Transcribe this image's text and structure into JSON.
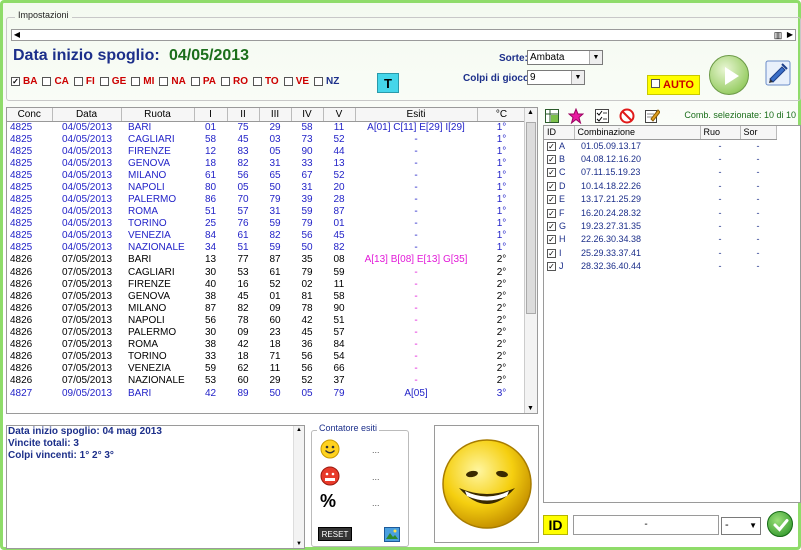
{
  "settings": {
    "title": "Impostazioni",
    "date_label": "Data inizio spoglio:",
    "date_value": "04/05/2013",
    "wheels": [
      {
        "label": "BA",
        "checked": true
      },
      {
        "label": "CA",
        "checked": false
      },
      {
        "label": "FI",
        "checked": false
      },
      {
        "label": "GE",
        "checked": false
      },
      {
        "label": "MI",
        "checked": false
      },
      {
        "label": "NA",
        "checked": false
      },
      {
        "label": "PA",
        "checked": false
      },
      {
        "label": "RO",
        "checked": false
      },
      {
        "label": "TO",
        "checked": false
      },
      {
        "label": "VE",
        "checked": false
      },
      {
        "label": "NZ",
        "checked": false
      }
    ],
    "t_button": "T",
    "sorte_label": "Sorte:",
    "sorte_value": "Ambata",
    "colpi_label": "Colpi di gioco:",
    "colpi_value": "9",
    "auto_label": "AUTO"
  },
  "grid": {
    "columns": [
      "Conc",
      "Data",
      "Ruota",
      "I",
      "II",
      "III",
      "IV",
      "V",
      "Esiti",
      "°C"
    ],
    "rows": [
      [
        "4825",
        "04/05/2013",
        "BARI",
        "01",
        "75",
        "29",
        "58",
        "11",
        "A[01] C[11] E[29] I[29]",
        "1°"
      ],
      [
        "4825",
        "04/05/2013",
        "CAGLIARI",
        "58",
        "45",
        "03",
        "73",
        "52",
        "-",
        "1°"
      ],
      [
        "4825",
        "04/05/2013",
        "FIRENZE",
        "12",
        "83",
        "05",
        "90",
        "44",
        "-",
        "1°"
      ],
      [
        "4825",
        "04/05/2013",
        "GENOVA",
        "18",
        "82",
        "31",
        "33",
        "13",
        "-",
        "1°"
      ],
      [
        "4825",
        "04/05/2013",
        "MILANO",
        "61",
        "56",
        "65",
        "67",
        "52",
        "-",
        "1°"
      ],
      [
        "4825",
        "04/05/2013",
        "NAPOLI",
        "80",
        "05",
        "50",
        "31",
        "20",
        "-",
        "1°"
      ],
      [
        "4825",
        "04/05/2013",
        "PALERMO",
        "86",
        "70",
        "79",
        "39",
        "28",
        "-",
        "1°"
      ],
      [
        "4825",
        "04/05/2013",
        "ROMA",
        "51",
        "57",
        "31",
        "59",
        "87",
        "-",
        "1°"
      ],
      [
        "4825",
        "04/05/2013",
        "TORINO",
        "25",
        "76",
        "59",
        "79",
        "01",
        "-",
        "1°"
      ],
      [
        "4825",
        "04/05/2013",
        "VENEZIA",
        "84",
        "61",
        "82",
        "56",
        "45",
        "-",
        "1°"
      ],
      [
        "4825",
        "04/05/2013",
        "NAZIONALE",
        "34",
        "51",
        "59",
        "50",
        "82",
        "-",
        "1°"
      ],
      [
        "4826",
        "07/05/2013",
        "BARI",
        "13",
        "77",
        "87",
        "35",
        "08",
        "A[13] B[08] E[13] G[35]",
        "2°"
      ],
      [
        "4826",
        "07/05/2013",
        "CAGLIARI",
        "30",
        "53",
        "61",
        "79",
        "59",
        "-",
        "2°"
      ],
      [
        "4826",
        "07/05/2013",
        "FIRENZE",
        "40",
        "16",
        "52",
        "02",
        "11",
        "-",
        "2°"
      ],
      [
        "4826",
        "07/05/2013",
        "GENOVA",
        "38",
        "45",
        "01",
        "81",
        "58",
        "-",
        "2°"
      ],
      [
        "4826",
        "07/05/2013",
        "MILANO",
        "87",
        "82",
        "09",
        "78",
        "90",
        "-",
        "2°"
      ],
      [
        "4826",
        "07/05/2013",
        "NAPOLI",
        "56",
        "78",
        "60",
        "42",
        "51",
        "-",
        "2°"
      ],
      [
        "4826",
        "07/05/2013",
        "PALERMO",
        "30",
        "09",
        "23",
        "45",
        "57",
        "-",
        "2°"
      ],
      [
        "4826",
        "07/05/2013",
        "ROMA",
        "38",
        "42",
        "18",
        "36",
        "84",
        "-",
        "2°"
      ],
      [
        "4826",
        "07/05/2013",
        "TORINO",
        "33",
        "18",
        "71",
        "56",
        "54",
        "-",
        "2°"
      ],
      [
        "4826",
        "07/05/2013",
        "VENEZIA",
        "59",
        "62",
        "11",
        "56",
        "66",
        "-",
        "2°"
      ],
      [
        "4826",
        "07/05/2013",
        "NAZIONALE",
        "53",
        "60",
        "29",
        "52",
        "37",
        "-",
        "2°"
      ],
      [
        "4827",
        "09/05/2013",
        "BARI",
        "42",
        "89",
        "50",
        "05",
        "79",
        "A[05]",
        "3°"
      ]
    ]
  },
  "info": {
    "line1": "Data inizio spoglio: 04 mag 2013",
    "line2": "Vincite totali: 3",
    "line3": "Colpi vincenti: 1° 2° 3°"
  },
  "counter": {
    "title": "Contatore esiti",
    "happy_value": "...",
    "sad_value": "...",
    "percent_symbol": "%",
    "percent_value": "...",
    "reset_label": "RESET"
  },
  "combinations": {
    "selected_label": "Comb. selezionate: 10 di 10",
    "columns": [
      "ID",
      "Combinazione",
      "Ruo",
      "Sor"
    ],
    "rows": [
      [
        "A",
        "01.05.09.13.17",
        "-",
        "-"
      ],
      [
        "B",
        "04.08.12.16.20",
        "-",
        "-"
      ],
      [
        "C",
        "07.11.15.19.23",
        "-",
        "-"
      ],
      [
        "D",
        "10.14.18.22.26",
        "-",
        "-"
      ],
      [
        "E",
        "13.17.21.25.29",
        "-",
        "-"
      ],
      [
        "F",
        "16.20.24.28.32",
        "-",
        "-"
      ],
      [
        "G",
        "19.23.27.31.35",
        "-",
        "-"
      ],
      [
        "H",
        "22.26.30.34.38",
        "-",
        "-"
      ],
      [
        "I",
        "25.29.33.37.41",
        "-",
        "-"
      ],
      [
        "J",
        "28.32.36.40.44",
        "-",
        "-"
      ]
    ]
  },
  "bottom": {
    "id_label": "ID",
    "id_value": "-",
    "id_select_value": "-"
  },
  "colors": {
    "frame_green": "#8fdc6a",
    "title_blue": "#1c2f8a",
    "date_green": "#1b6e1b",
    "esiti_magenta": "#e21ad8",
    "auto_yellow": "#ffff00"
  }
}
